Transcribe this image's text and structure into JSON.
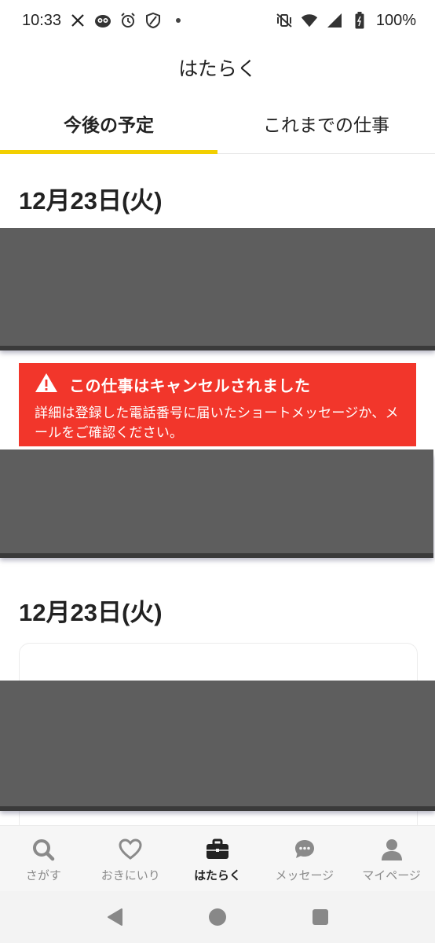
{
  "status_bar": {
    "time": "10:33",
    "battery": "100%",
    "left_icons": [
      "x-icon",
      "owl-app-icon",
      "alarm-icon",
      "shield-icon",
      "dot-icon"
    ],
    "right_icons": [
      "vibrate-off-icon",
      "wifi-icon",
      "signal-icon",
      "battery-icon"
    ]
  },
  "header": {
    "title": "はたらく"
  },
  "tabs": [
    {
      "label": "今後の予定",
      "active": true
    },
    {
      "label": "これまでの仕事",
      "active": false
    }
  ],
  "sections": [
    {
      "date": "12月23日(火)",
      "cancel_notice": {
        "title": "この仕事はキャンセルされました",
        "body": "詳細は登録した電話番号に届いたショートメッセージか、メールをご確認ください。"
      }
    },
    {
      "date": "12月23日(火)"
    }
  ],
  "bottom_nav": [
    {
      "label": "さがす",
      "icon": "search-icon",
      "active": false
    },
    {
      "label": "おきにいり",
      "icon": "heart-icon",
      "active": false
    },
    {
      "label": "はたらく",
      "icon": "briefcase-icon",
      "active": true
    },
    {
      "label": "メッセージ",
      "icon": "chat-icon",
      "active": false
    },
    {
      "label": "マイページ",
      "icon": "person-icon",
      "active": false
    }
  ],
  "colors": {
    "accent": "#f2cf00",
    "cancel_banner": "#f2362b",
    "redaction": "#5e5e5e"
  }
}
